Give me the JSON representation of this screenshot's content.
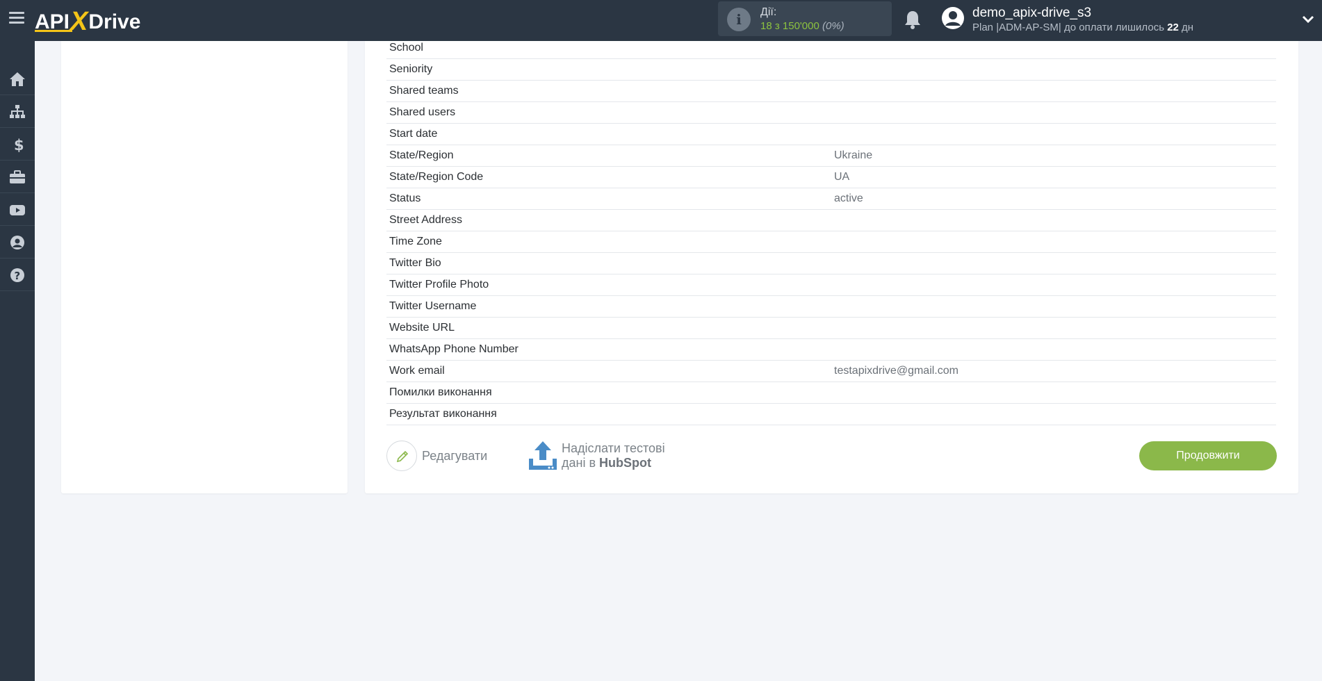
{
  "header": {
    "logo_left": "API",
    "logo_x": "X",
    "logo_right": "Drive",
    "actions_label": "Дії:",
    "actions_count": "18 з 150'000",
    "actions_pct": "(0%)",
    "username": "demo_apix-drive_s3",
    "plan_prefix": "Plan |ADM-AP-SM| до оплати лишилось ",
    "plan_days": "22",
    "plan_suffix": " дн"
  },
  "sidebar": {
    "items": [
      {
        "icon": "home-icon"
      },
      {
        "icon": "sitemap-icon"
      },
      {
        "icon": "dollar-icon"
      },
      {
        "icon": "briefcase-icon"
      },
      {
        "icon": "youtube-icon"
      },
      {
        "icon": "user-circle-icon"
      },
      {
        "icon": "help-icon"
      }
    ]
  },
  "fields": [
    {
      "key": "School",
      "value": ""
    },
    {
      "key": "Seniority",
      "value": ""
    },
    {
      "key": "Shared teams",
      "value": ""
    },
    {
      "key": "Shared users",
      "value": ""
    },
    {
      "key": "Start date",
      "value": ""
    },
    {
      "key": "State/Region",
      "value": "Ukraine"
    },
    {
      "key": "State/Region Code",
      "value": "UA"
    },
    {
      "key": "Status",
      "value": "active"
    },
    {
      "key": "Street Address",
      "value": ""
    },
    {
      "key": "Time Zone",
      "value": ""
    },
    {
      "key": "Twitter Bio",
      "value": ""
    },
    {
      "key": "Twitter Profile Photo",
      "value": ""
    },
    {
      "key": "Twitter Username",
      "value": ""
    },
    {
      "key": "Website URL",
      "value": ""
    },
    {
      "key": "WhatsApp Phone Number",
      "value": ""
    },
    {
      "key": "Work email",
      "value": "testapixdrive@gmail.com"
    },
    {
      "key": "Помилки виконання",
      "value": ""
    },
    {
      "key": "Результат виконання",
      "value": ""
    }
  ],
  "buttons": {
    "edit_label": "Редагувати",
    "send_line1": "Надіслати тестові",
    "send_line2_prefix": "дані в ",
    "send_line2_service": "HubSpot",
    "continue_label": "Продовжити"
  },
  "colors": {
    "topbar": "#2b3643",
    "accent_green": "#8bb84a",
    "logo_yellow": "#f5c518",
    "upload_blue": "#4a8cc7"
  }
}
